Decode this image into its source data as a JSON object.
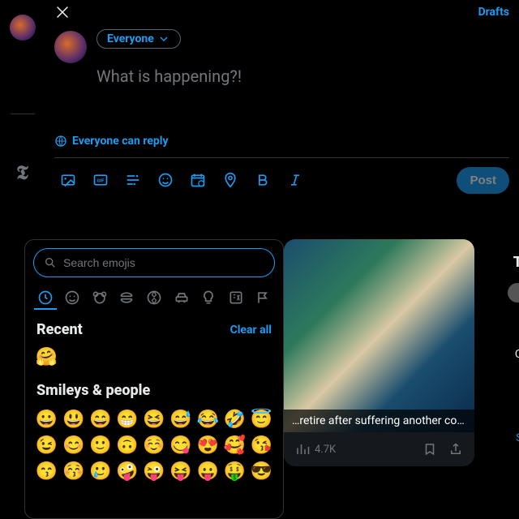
{
  "header": {
    "drafts_label": "Drafts"
  },
  "compose": {
    "audience_label": "Everyone",
    "placeholder": "What is happening?!",
    "reply_label": "Everyone can reply",
    "post_label": "Post"
  },
  "emoji_picker": {
    "search_placeholder": "Search emojis",
    "recent_title": "Recent",
    "clear_label": "Clear all",
    "recent_emojis": [
      "🤗"
    ],
    "smileys_title": "Smileys & people",
    "smileys_row1": [
      "😀",
      "😃",
      "😄",
      "😁",
      "😆",
      "😅",
      "😂",
      "🤣",
      "😇"
    ],
    "smileys_row2": [
      "😉",
      "😊",
      "🙂",
      "🙃",
      "☺️",
      "😋",
      "😍",
      "🥰",
      "😘"
    ],
    "smileys_row3": [
      "😙",
      "😚",
      "🥲",
      "🤪",
      "😜",
      "😝",
      "😛",
      "🤑",
      "😎"
    ],
    "categories": [
      "recent",
      "smileys",
      "animals",
      "food",
      "activity",
      "travel",
      "objects",
      "symbols",
      "flags"
    ]
  },
  "feed": {
    "headline": "…retire after suffering another co…",
    "views": "4.7K"
  },
  "right": {
    "t1": "T",
    "t2": "C",
    "t3": "S"
  }
}
